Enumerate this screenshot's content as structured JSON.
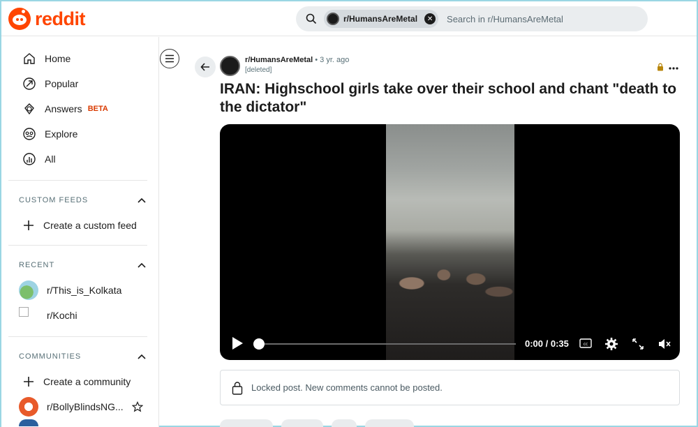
{
  "header": {
    "logo_text": "reddit",
    "search": {
      "chip_label": "r/HumansAreMetal",
      "placeholder": "Search in r/HumansAreMetal"
    }
  },
  "sidebar": {
    "nav": [
      {
        "label": "Home",
        "icon": "home-icon"
      },
      {
        "label": "Popular",
        "icon": "popular-icon"
      },
      {
        "label": "Answers",
        "icon": "answers-icon",
        "badge": "BETA"
      },
      {
        "label": "Explore",
        "icon": "explore-icon"
      },
      {
        "label": "All",
        "icon": "all-icon"
      }
    ],
    "custom_feeds": {
      "title": "CUSTOM FEEDS",
      "create_label": "Create a custom feed"
    },
    "recent": {
      "title": "RECENT",
      "items": [
        {
          "label": "r/This_is_Kolkata"
        },
        {
          "label": "r/Kochi"
        }
      ]
    },
    "communities": {
      "title": "COMMUNITIES",
      "create_label": "Create a community",
      "items": [
        {
          "label": "r/BollyBlindsNG..."
        }
      ]
    }
  },
  "post": {
    "subreddit": "r/HumansAreMetal",
    "age": "• 3 yr. ago",
    "author": "[deleted]",
    "title": "IRAN: Highschool girls take over their school and chant \"death to the dictator\"",
    "video": {
      "time": "0:00 / 0:35",
      "progress": 0
    },
    "locked_notice": "Locked post. New comments cannot be posted."
  },
  "colors": {
    "brand": "#ff4500",
    "beta": "#d93a00",
    "lock": "#b8860b"
  }
}
